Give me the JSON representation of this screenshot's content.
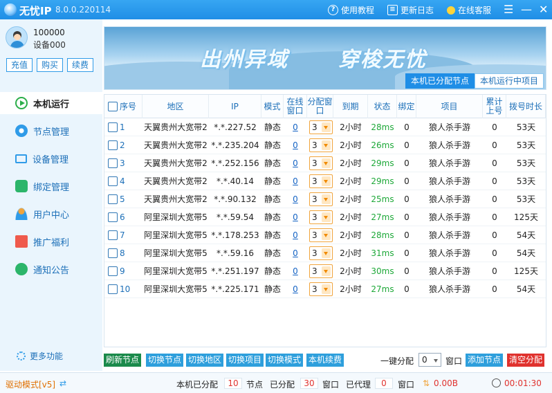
{
  "titlebar": {
    "app_name": "无忧IP",
    "version": "8.0.0.220114",
    "tutorial": "使用教程",
    "changelog": "更新日志",
    "support": "在线客服",
    "menu": "☰",
    "minimize": "—",
    "close": "✕"
  },
  "user": {
    "id": "100000",
    "device": "设备000"
  },
  "account_buttons": {
    "recharge": "充值",
    "buy": "购买",
    "renew": "续费"
  },
  "nav": [
    {
      "label": "本机运行"
    },
    {
      "label": "节点管理"
    },
    {
      "label": "设备管理"
    },
    {
      "label": "绑定管理"
    },
    {
      "label": "用户中心"
    },
    {
      "label": "推广福利"
    },
    {
      "label": "通知公告"
    }
  ],
  "more": "更多功能",
  "banner": {
    "slogan_left": "出州异域",
    "slogan_right": "穿梭无忧"
  },
  "tabs": [
    {
      "label": "本机已分配节点"
    },
    {
      "label": "本机运行中项目"
    }
  ],
  "columns": [
    "序号",
    "地区",
    "IP",
    "模式",
    "在线窗口",
    "分配窗口",
    "到期",
    "状态",
    "绑定",
    "项目",
    "累计上号",
    "拨号时长"
  ],
  "rows": [
    {
      "no": "1",
      "region": "天翼贵州大宽带2",
      "ip": "*.*.227.52",
      "mode": "静态",
      "online": "0",
      "alloc": "3",
      "expire": "2小时",
      "status": "28ms",
      "bind": "0",
      "project": "狼人杀手游",
      "total": "0",
      "duration": "53天"
    },
    {
      "no": "2",
      "region": "天翼贵州大宽带2",
      "ip": "*.*.235.204",
      "mode": "静态",
      "online": "0",
      "alloc": "3",
      "expire": "2小时",
      "status": "26ms",
      "bind": "0",
      "project": "狼人杀手游",
      "total": "0",
      "duration": "53天"
    },
    {
      "no": "3",
      "region": "天翼贵州大宽带2",
      "ip": "*.*.252.156",
      "mode": "静态",
      "online": "0",
      "alloc": "3",
      "expire": "2小时",
      "status": "29ms",
      "bind": "0",
      "project": "狼人杀手游",
      "total": "0",
      "duration": "53天"
    },
    {
      "no": "4",
      "region": "天翼贵州大宽带2",
      "ip": "*.*.40.14",
      "mode": "静态",
      "online": "0",
      "alloc": "3",
      "expire": "2小时",
      "status": "29ms",
      "bind": "0",
      "project": "狼人杀手游",
      "total": "0",
      "duration": "53天"
    },
    {
      "no": "5",
      "region": "天翼贵州大宽带2",
      "ip": "*.*.90.132",
      "mode": "静态",
      "online": "0",
      "alloc": "3",
      "expire": "2小时",
      "status": "25ms",
      "bind": "0",
      "project": "狼人杀手游",
      "total": "0",
      "duration": "53天"
    },
    {
      "no": "6",
      "region": "阿里深圳大宽带5",
      "ip": "*.*.59.54",
      "mode": "静态",
      "online": "0",
      "alloc": "3",
      "expire": "2小时",
      "status": "27ms",
      "bind": "0",
      "project": "狼人杀手游",
      "total": "0",
      "duration": "125天"
    },
    {
      "no": "7",
      "region": "阿里深圳大宽带5",
      "ip": "*.*.178.253",
      "mode": "静态",
      "online": "0",
      "alloc": "3",
      "expire": "2小时",
      "status": "28ms",
      "bind": "0",
      "project": "狼人杀手游",
      "total": "0",
      "duration": "54天"
    },
    {
      "no": "8",
      "region": "阿里深圳大宽带5",
      "ip": "*.*.59.16",
      "mode": "静态",
      "online": "0",
      "alloc": "3",
      "expire": "2小时",
      "status": "31ms",
      "bind": "0",
      "project": "狼人杀手游",
      "total": "0",
      "duration": "54天"
    },
    {
      "no": "9",
      "region": "阿里深圳大宽带5",
      "ip": "*.*.251.197",
      "mode": "静态",
      "online": "0",
      "alloc": "3",
      "expire": "2小时",
      "status": "30ms",
      "bind": "0",
      "project": "狼人杀手游",
      "total": "0",
      "duration": "125天"
    },
    {
      "no": "10",
      "region": "阿里深圳大宽带5",
      "ip": "*.*.225.171",
      "mode": "静态",
      "online": "0",
      "alloc": "3",
      "expire": "2小时",
      "status": "27ms",
      "bind": "0",
      "project": "狼人杀手游",
      "total": "0",
      "duration": "54天"
    }
  ],
  "actions": {
    "refresh": "刷新节点",
    "switch_node": "切换节点",
    "switch_region": "切换地区",
    "switch_project": "切换项目",
    "switch_mode": "切换模式",
    "renew": "本机续费",
    "one_click": "一键分配",
    "one_click_value": "0",
    "window": "窗口",
    "add_node": "添加节点",
    "clear_alloc": "清空分配"
  },
  "status": {
    "driver_mode": "驱动模式[v5]",
    "assigned_label": "本机已分配",
    "assigned_value": "10",
    "node_unit": "节点",
    "allocated_label": "已分配",
    "allocated_value": "30",
    "window_unit": "窗口",
    "proxied_label": "已代理",
    "proxied_value": "0",
    "window_unit2": "窗口",
    "speed": "0.00B",
    "timer": "00:01:30"
  },
  "colors": {
    "accent": "#1f8ee6",
    "green": "#1da838",
    "red": "#e0322e",
    "orange": "#f0a43b"
  }
}
